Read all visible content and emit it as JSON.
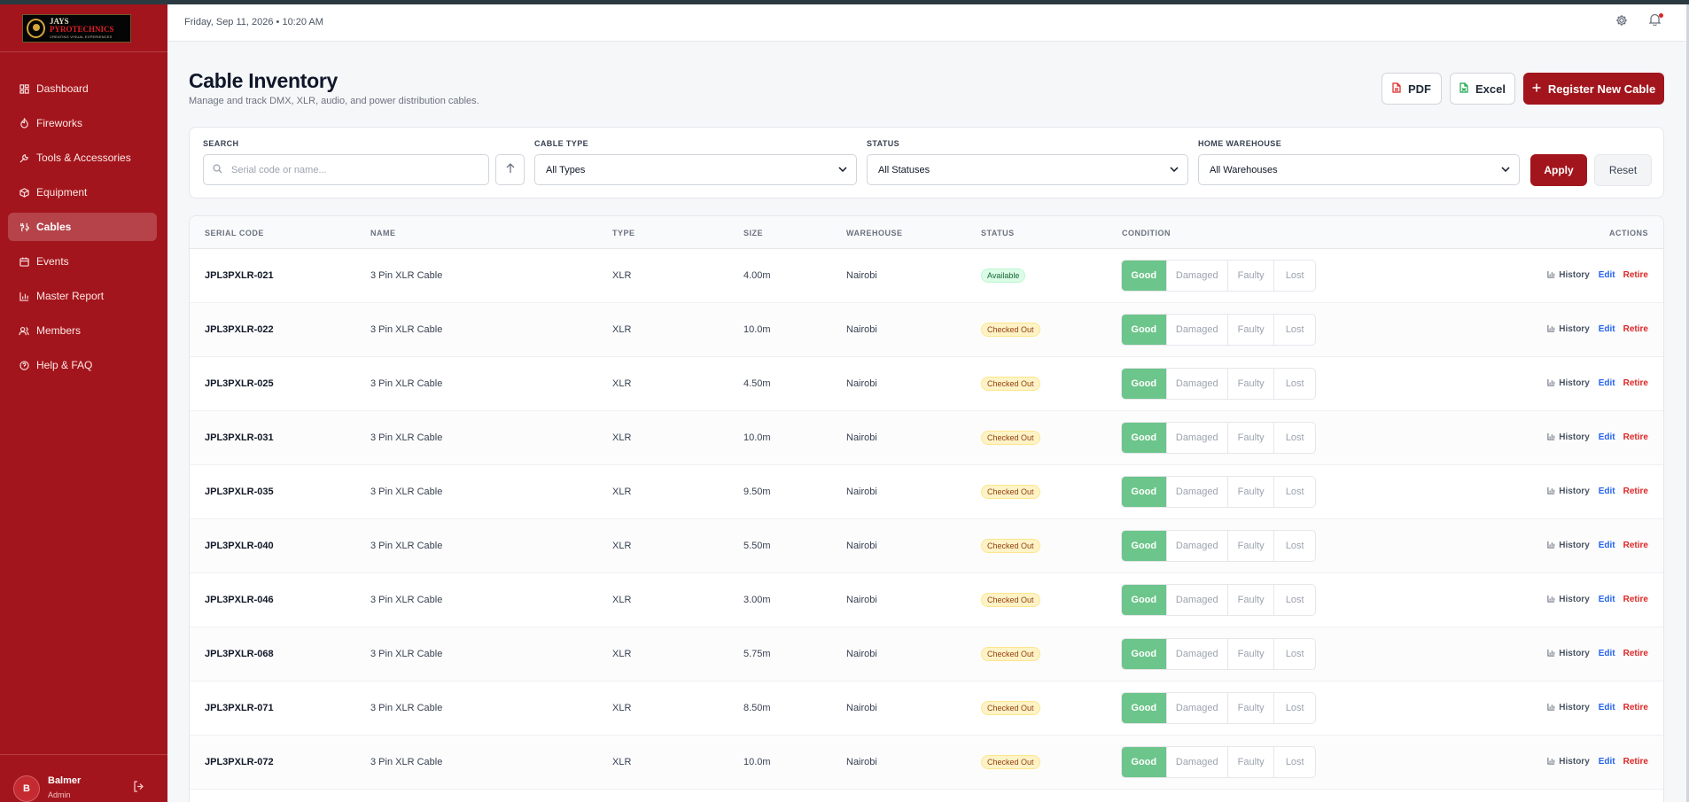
{
  "brand": {
    "logo_line1": "JAYS",
    "logo_line2": "PYROTECHNICS",
    "logo_tagline": "CREATING VISUAL EXPERIENCES"
  },
  "sidebar": {
    "items": [
      {
        "label": "Dashboard",
        "icon": "dashboard-icon"
      },
      {
        "label": "Fireworks",
        "icon": "flame-icon"
      },
      {
        "label": "Tools & Accessories",
        "icon": "wrench-icon"
      },
      {
        "label": "Equipment",
        "icon": "box-icon"
      },
      {
        "label": "Cables",
        "icon": "cable-icon",
        "active": true
      },
      {
        "label": "Events",
        "icon": "calendar-icon"
      },
      {
        "label": "Master Report",
        "icon": "bar-chart-icon"
      },
      {
        "label": "Members",
        "icon": "users-icon"
      },
      {
        "label": "Help & FAQ",
        "icon": "help-icon"
      }
    ],
    "user": {
      "initial": "B",
      "name": "Balmer",
      "role": "Admin"
    }
  },
  "topbar": {
    "datetime": "Friday, Sep 11, 2026  •  10:20 AM"
  },
  "header": {
    "title": "Cable Inventory",
    "subtitle": "Manage and track DMX, XLR, audio, and power distribution cables.",
    "pdf_label": "PDF",
    "excel_label": "Excel",
    "register_label": "Register New Cable"
  },
  "filters": {
    "search_label": "SEARCH",
    "search_placeholder": "Serial code or name...",
    "type_label": "CABLE TYPE",
    "type_value": "All Types",
    "status_label": "STATUS",
    "status_value": "All Statuses",
    "warehouse_label": "HOME WAREHOUSE",
    "warehouse_value": "All Warehouses",
    "apply_label": "Apply",
    "reset_label": "Reset"
  },
  "table": {
    "columns": [
      "SERIAL CODE",
      "NAME",
      "TYPE",
      "SIZE",
      "WAREHOUSE",
      "STATUS",
      "CONDITION",
      "ACTIONS"
    ],
    "condition_options": [
      "Good",
      "Damaged",
      "Faulty",
      "Lost"
    ],
    "action_labels": {
      "history": "History",
      "edit": "Edit",
      "retire": "Retire"
    },
    "rows": [
      {
        "code": "JPL3PXLR-021",
        "name": "3 Pin XLR Cable",
        "type": "XLR",
        "size": "4.00m",
        "warehouse": "Nairobi",
        "status": "Available",
        "condition": "Good"
      },
      {
        "code": "JPL3PXLR-022",
        "name": "3 Pin XLR Cable",
        "type": "XLR",
        "size": "10.0m",
        "warehouse": "Nairobi",
        "status": "Checked Out",
        "condition": "Good"
      },
      {
        "code": "JPL3PXLR-025",
        "name": "3 Pin XLR Cable",
        "type": "XLR",
        "size": "4.50m",
        "warehouse": "Nairobi",
        "status": "Checked Out",
        "condition": "Good"
      },
      {
        "code": "JPL3PXLR-031",
        "name": "3 Pin XLR Cable",
        "type": "XLR",
        "size": "10.0m",
        "warehouse": "Nairobi",
        "status": "Checked Out",
        "condition": "Good"
      },
      {
        "code": "JPL3PXLR-035",
        "name": "3 Pin XLR Cable",
        "type": "XLR",
        "size": "9.50m",
        "warehouse": "Nairobi",
        "status": "Checked Out",
        "condition": "Good"
      },
      {
        "code": "JPL3PXLR-040",
        "name": "3 Pin XLR Cable",
        "type": "XLR",
        "size": "5.50m",
        "warehouse": "Nairobi",
        "status": "Checked Out",
        "condition": "Good"
      },
      {
        "code": "JPL3PXLR-046",
        "name": "3 Pin XLR Cable",
        "type": "XLR",
        "size": "3.00m",
        "warehouse": "Nairobi",
        "status": "Checked Out",
        "condition": "Good"
      },
      {
        "code": "JPL3PXLR-068",
        "name": "3 Pin XLR Cable",
        "type": "XLR",
        "size": "5.75m",
        "warehouse": "Nairobi",
        "status": "Checked Out",
        "condition": "Good"
      },
      {
        "code": "JPL3PXLR-071",
        "name": "3 Pin XLR Cable",
        "type": "XLR",
        "size": "8.50m",
        "warehouse": "Nairobi",
        "status": "Checked Out",
        "condition": "Good"
      },
      {
        "code": "JPL3PXLR-072",
        "name": "3 Pin XLR Cable",
        "type": "XLR",
        "size": "10.0m",
        "warehouse": "Nairobi",
        "status": "Checked Out",
        "condition": "Good"
      }
    ]
  },
  "colors": {
    "brand_red": "#a3151c",
    "good_green": "#6cc58a",
    "available_bg": "#dcfce7",
    "checked_out_bg": "#fef3c7",
    "edit_blue": "#2563eb",
    "retire_red": "#dc2626"
  }
}
